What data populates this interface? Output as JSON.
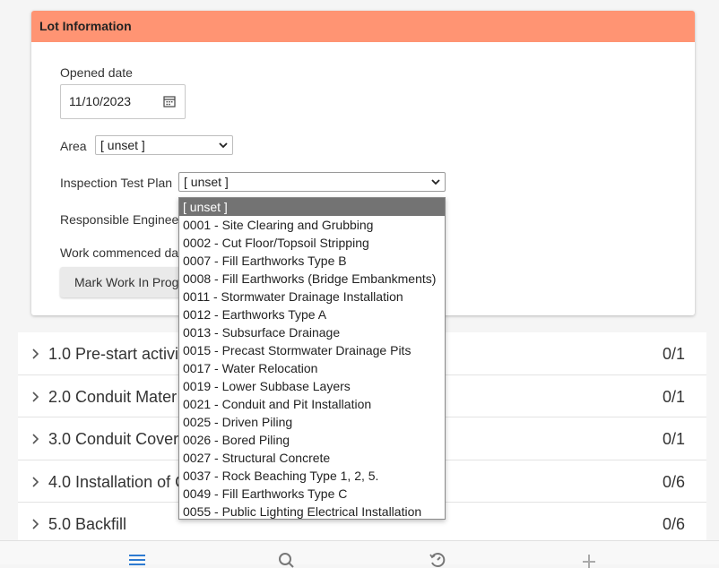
{
  "lot_info": {
    "header": "Lot Information",
    "opened_label": "Opened date",
    "opened_value": "11/10/2023",
    "area_label": "Area",
    "area_value": "[ unset ]",
    "itp_label": "Inspection Test Plan",
    "itp_value": "[ unset ]",
    "engineer_label": "Responsible Engineer",
    "work_commenced_label": "Work commenced da",
    "mark_button": "Mark Work In Prog"
  },
  "sections": [
    {
      "title": "1.0 Pre-start activi",
      "count": "0/1"
    },
    {
      "title": "2.0 Conduit Mater",
      "count": "0/1"
    },
    {
      "title": "3.0 Conduit Cover",
      "count": "0/1"
    },
    {
      "title": "4.0 Installation of C",
      "count": "0/6"
    },
    {
      "title": "5.0 Backfill",
      "count": "0/6"
    }
  ],
  "dropdown": {
    "options": [
      "[ unset ]",
      "0001 - Site Clearing and Grubbing",
      "0002 - Cut Floor/Topsoil Stripping",
      "0007 - Fill Earthworks Type B",
      "0008 - Fill Earthworks (Bridge Embankments)",
      "0011 - Stormwater Drainage Installation",
      "0012 - Earthworks Type A",
      "0013 - Subsurface Drainage",
      "0015 - Precast Stormwater Drainage Pits",
      "0017 - Water Relocation",
      "0019 - Lower Subbase Layers",
      "0021 - Conduit and Pit Installation",
      "0025 - Driven Piling",
      "0026 - Bored Piling",
      "0027 - Structural Concrete",
      "0037 - Rock Beaching Type 1, 2, 5.",
      "0049 - Fill Earthworks Type C",
      "0055 - Public Lighting Electrical Installation"
    ],
    "selected_index": 0
  },
  "bottom_nav": {
    "icons": [
      "menu-icon",
      "search-icon",
      "history-icon",
      "plus-icon"
    ]
  },
  "colors": {
    "header_bg": "#ff9473",
    "selected_option_bg": "#737373",
    "nav_active": "#2f7bd1"
  }
}
